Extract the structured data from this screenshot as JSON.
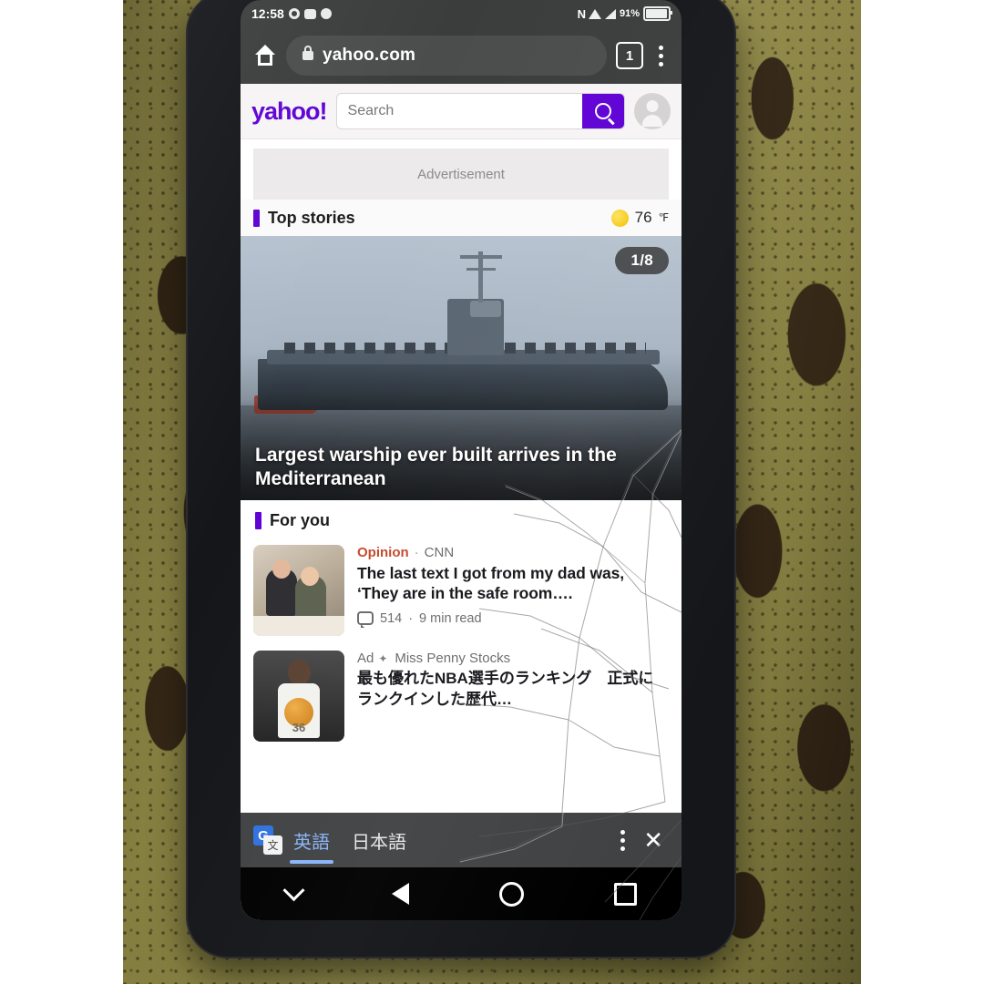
{
  "status_bar": {
    "time": "12:58",
    "nfc": "N",
    "battery_percent": "91%",
    "icons": [
      "gear-icon",
      "notification-icon",
      "notification-icon-2",
      "nfc-icon",
      "wifi-icon",
      "signal-icon",
      "battery-icon"
    ]
  },
  "browser": {
    "url": "yahoo.com",
    "tab_count": "1",
    "home_icon": "home-icon",
    "lock_icon": "lock-icon",
    "menu_icon": "kebab-menu-icon"
  },
  "yahoo_header": {
    "logo": "yahoo!",
    "search_placeholder": "Search",
    "search_value": "",
    "search_button_icon": "magnifier-icon",
    "account_icon": "avatar-icon"
  },
  "ad_slot": {
    "label": "Advertisement"
  },
  "top_stories": {
    "title": "Top stories",
    "weather_temp": "76",
    "weather_unit": "℉",
    "weather_icon": "sun-icon",
    "carousel_counter": "1/8",
    "headline": "Largest warship ever built arrives in the Mediterranean"
  },
  "for_you": {
    "title": "For you",
    "items": [
      {
        "kicker": "Opinion",
        "separator": "·",
        "source": "CNN",
        "title": "The last text I got from my dad was, ‘They are in the safe room….",
        "comments": "514",
        "meta_sep": "·",
        "read_time": "9 min read"
      },
      {
        "kicker": "Ad",
        "source": "Miss Penny Stocks",
        "title": "最も優れたNBA選手のランキング　正式にランクインした歴代…"
      }
    ]
  },
  "translate_bar": {
    "app_icon": "google-translate-icon",
    "icon_letter": "G",
    "icon_glyph": "文",
    "source_language": "英語",
    "target_language": "日本語",
    "menu_icon": "kebab-menu-icon",
    "close_label": "✕"
  },
  "nav_bar": {
    "hide_icon": "chevron-down-icon",
    "back_icon": "back-triangle-icon",
    "home_icon": "home-circle-icon",
    "recents_icon": "recents-square-icon"
  },
  "colors": {
    "yahoo_purple": "#5f01d5",
    "accent_blue": "#8ab4f8",
    "opinion_red": "#c3492c",
    "chrome_gray": "#3b3d3c"
  }
}
